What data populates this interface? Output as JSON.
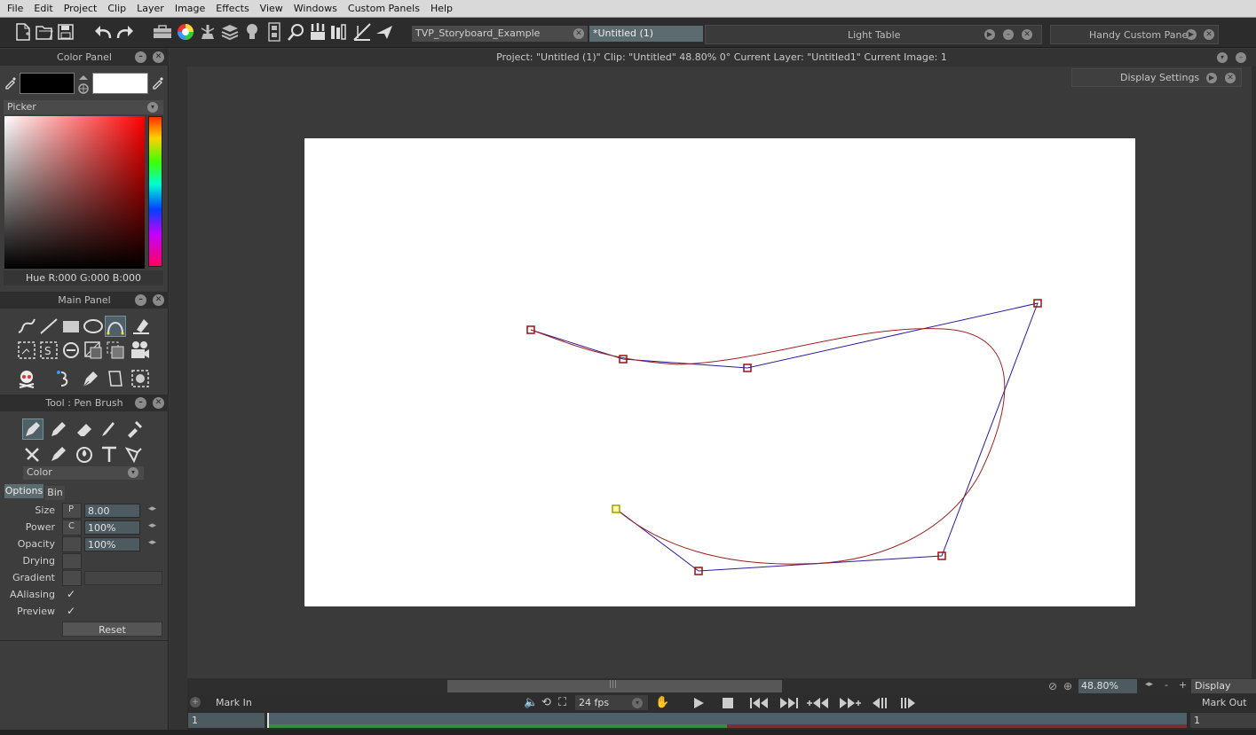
{
  "menu": [
    "File",
    "Edit",
    "Project",
    "Clip",
    "Layer",
    "Image",
    "Effects",
    "View",
    "Windows",
    "Custom Panels",
    "Help"
  ],
  "tabs": {
    "storyboard": "TVP_Storyboard_Example",
    "untitled": "*Untitled (1)",
    "light_table": "Light Table",
    "handy": "Handy Custom Pane"
  },
  "color_panel": {
    "title": "Color Panel",
    "picker_label": "Picker",
    "readout": "Hue R:000 G:000 B:000",
    "primary_color": "#000000",
    "secondary_color": "#ffffff"
  },
  "main_panel": {
    "title": "Main Panel"
  },
  "tool_panel": {
    "title": "Tool : Pen Brush",
    "mode": "Color",
    "tab_options": "Options",
    "tab_bin": "Bin",
    "size_label": "Size",
    "size_prefix": "P",
    "size_value": "8.00",
    "power_label": "Power",
    "power_prefix": "C",
    "power_value": "100%",
    "opacity_label": "Opacity",
    "opacity_value": "100%",
    "drying_label": "Drying",
    "gradient_label": "Gradient",
    "aaliasing_label": "AAliasing",
    "aaliasing_checked": true,
    "preview_label": "Preview",
    "preview_checked": true,
    "reset_label": "Reset"
  },
  "info": {
    "text": "Project:  \"Untitled (1)\"  Clip: \"Untitled\"   48.80%   0°  Current Layer: \"Untitled1\"  Current Image: 1"
  },
  "display_settings": "Display Settings",
  "zoom": {
    "value": "48.80%",
    "minus": "-",
    "plus": "+",
    "display": "Display"
  },
  "transport": {
    "mark_in": "Mark In",
    "fps": "24 fps",
    "mark_out": "Mark Out"
  },
  "timeline": {
    "start_frame": "1",
    "end_frame": "1"
  },
  "colors": {
    "accent": "#4d5a5f",
    "curve": "#a02020",
    "handle": "#2a1aa0"
  }
}
